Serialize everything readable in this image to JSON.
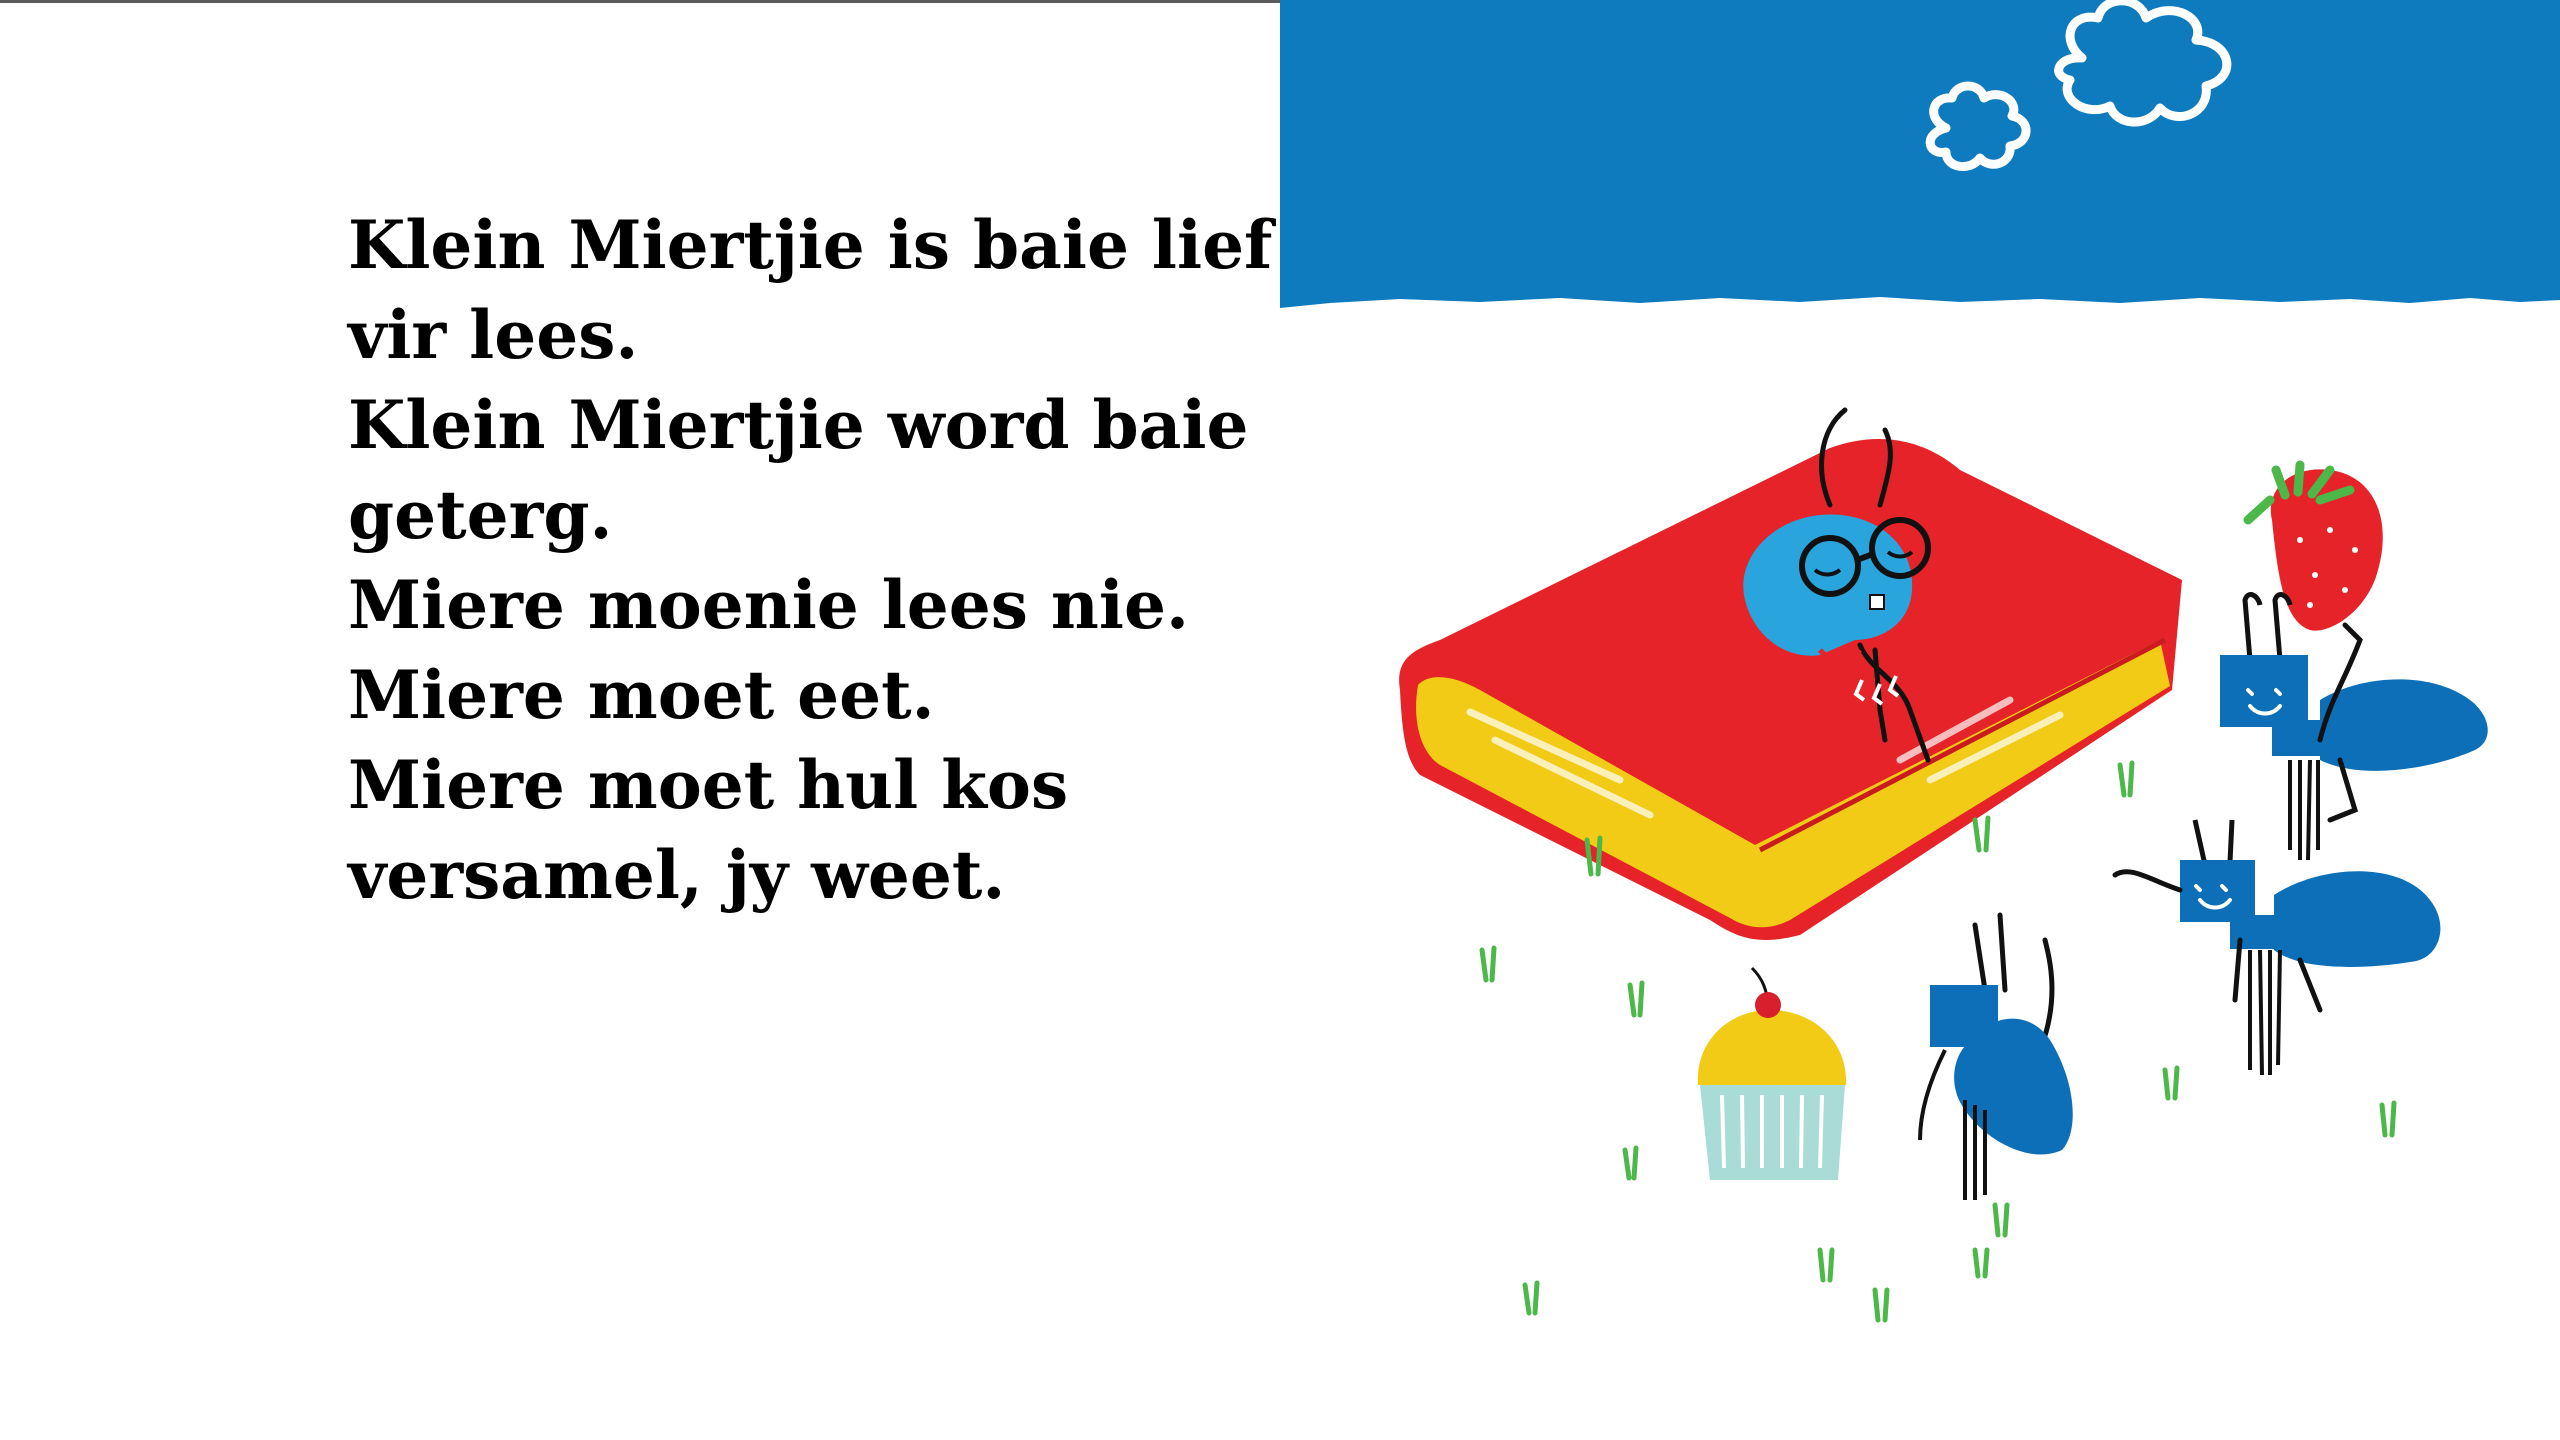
{
  "page": {
    "text_lines": [
      "Klein Miertjie is baie lief",
      "vir lees.",
      "Klein Miertjie word baie",
      "geterg.",
      "Miere moenie lees nie.",
      "Miere moet eet.",
      "Miere moet hul kos",
      "versamel, jy weet."
    ]
  },
  "colors": {
    "sky": "#0e7bbf",
    "book_cover": "#e52328",
    "book_pages": "#f2cb16",
    "ant_blue": "#0d6fb8",
    "reading_ant": "#2aa4dc",
    "grass": "#4cb84a",
    "cupcake_frosting": "#f2cb16",
    "cupcake_liner": "#a9dcd6",
    "strawberry": "#e52328",
    "cherry": "#d71f2d"
  },
  "illustration": {
    "icons": [
      "clouds-icon",
      "book-icon",
      "reading-ant-icon",
      "strawberry-icon",
      "cupcake-icon",
      "worker-ant-icon"
    ]
  }
}
